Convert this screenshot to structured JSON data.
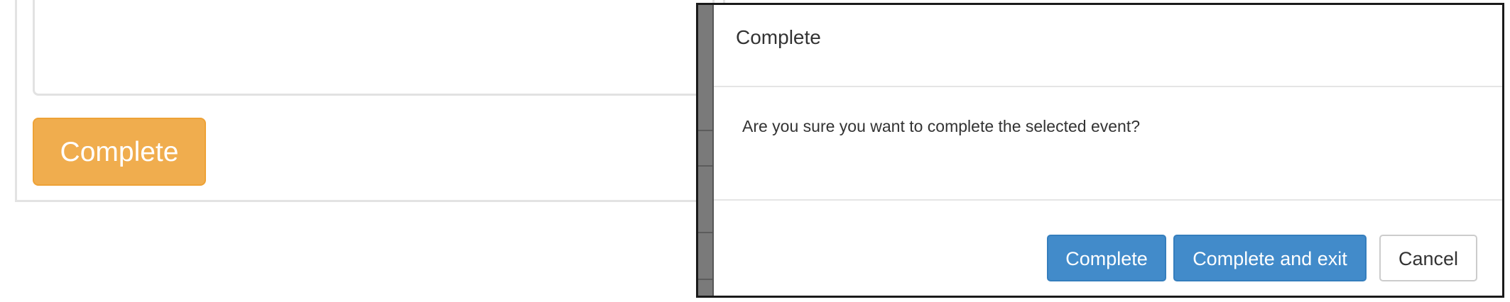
{
  "background": {
    "complete_button_label": "Complete",
    "colors": {
      "warning": "#f0ad4e",
      "panel_border": "#e3e3e3"
    }
  },
  "modal": {
    "title": "Complete",
    "message": "Are you sure you want to complete the selected event?",
    "buttons": {
      "complete": "Complete",
      "complete_and_exit": "Complete and exit",
      "cancel": "Cancel"
    },
    "colors": {
      "primary": "#428bca",
      "border": "#1a1a1a"
    }
  }
}
